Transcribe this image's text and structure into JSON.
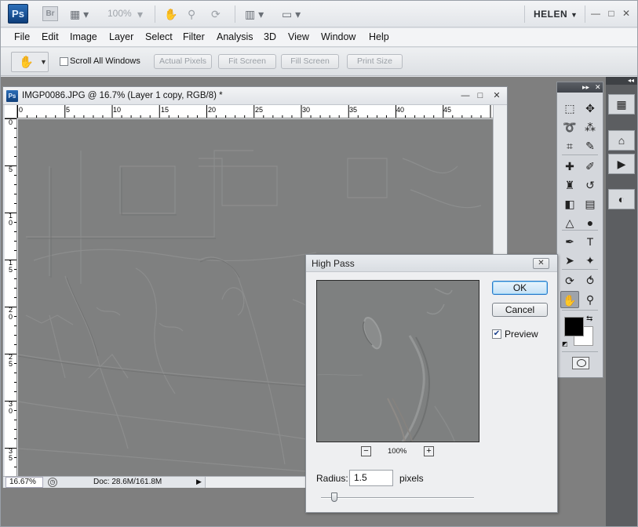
{
  "appbar": {
    "ps_logo": "Ps",
    "br_logo": "Br",
    "zoom": "100%",
    "user": "HELEN",
    "user_caret": "▼",
    "icons": [
      "film-icon",
      "hand-icon",
      "zoom-icon",
      "rotate-icon",
      "arrange-icon",
      "screen-mode-icon"
    ],
    "window_controls": {
      "minimize": "—",
      "restore": "□",
      "close": "✕"
    }
  },
  "menu": {
    "items": [
      "File",
      "Edit",
      "Image",
      "Layer",
      "Select",
      "Filter",
      "Analysis",
      "3D",
      "View",
      "Window",
      "Help"
    ]
  },
  "options": {
    "scroll_all_windows": "Scroll All Windows",
    "scroll_all_checked": false,
    "buttons": [
      "Actual Pixels",
      "Fit Screen",
      "Fill Screen",
      "Print Size"
    ]
  },
  "document": {
    "title": "IMGP0086.JPG @ 16.7% (Layer 1 copy, RGB/8) *",
    "ps_icon": "Ps",
    "ruler_h_labels": [
      "0",
      "5",
      "10",
      "15",
      "20",
      "25",
      "30",
      "35",
      "40",
      "45"
    ],
    "ruler_v_labels": [
      "0",
      "5",
      "1 0",
      "1 5",
      "2 0",
      "2 5",
      "3 0",
      "3 5"
    ],
    "zoom": "16.67%",
    "doc_info": "Doc: 28.6M/161.8M",
    "controls": {
      "minimize": "—",
      "restore": "□",
      "close": "✕"
    }
  },
  "tools": {
    "header": "▸▸",
    "header_close": "✕",
    "rows": [
      [
        "marquee-icon",
        "move-icon"
      ],
      [
        "lasso-icon",
        "magic-wand-icon"
      ],
      [
        "crop-icon",
        "eyedropper-icon"
      ],
      [
        "healing-brush-icon",
        "brush-icon"
      ],
      [
        "clone-stamp-icon",
        "history-brush-icon"
      ],
      [
        "eraser-icon",
        "gradient-icon"
      ],
      [
        "blur-icon",
        "dodge-icon"
      ],
      [
        "pen-icon",
        "type-icon"
      ],
      [
        "path-selection-icon",
        "custom-shape-icon"
      ],
      [
        "3d-rotate-icon",
        "3d-orbit-icon"
      ],
      [
        "hand-icon",
        "zoom-icon"
      ]
    ],
    "glyphs": {
      "marquee-icon": "⬚",
      "move-icon": "✥",
      "lasso-icon": "➰",
      "magic-wand-icon": "⁂",
      "crop-icon": "⌗",
      "eyedropper-icon": "✎",
      "healing-brush-icon": "✚",
      "brush-icon": "✐",
      "clone-stamp-icon": "♜",
      "history-brush-icon": "↺",
      "eraser-icon": "◧",
      "gradient-icon": "▤",
      "blur-icon": "△",
      "dodge-icon": "●",
      "pen-icon": "✒",
      "type-icon": "T",
      "path-selection-icon": "➤",
      "custom-shape-icon": "✦",
      "3d-rotate-icon": "⟳",
      "3d-orbit-icon": "⥀",
      "hand-icon": "✋",
      "zoom-icon": "⚲"
    },
    "active_tool": "hand-icon",
    "foreground_color": "#000000",
    "background_color": "#ffffff"
  },
  "dock": {
    "header": "◂◂",
    "buttons": [
      "histogram-icon",
      "mini-bridge-icon",
      "actions-icon",
      "adjustments-icon"
    ],
    "glyphs": {
      "histogram-icon": "▦",
      "mini-bridge-icon": "⌂",
      "actions-icon": "▶",
      "adjustments-icon": "◐"
    }
  },
  "dialog": {
    "title": "High Pass",
    "close": "✕",
    "ok": "OK",
    "cancel": "Cancel",
    "preview_label": "Preview",
    "preview_checked": true,
    "zoom_minus": "−",
    "zoom_plus": "+",
    "zoom_level": "100%",
    "radius_label": "Radius:",
    "radius_value": "1.5",
    "radius_unit": "pixels",
    "slider_fraction": 0.07
  }
}
